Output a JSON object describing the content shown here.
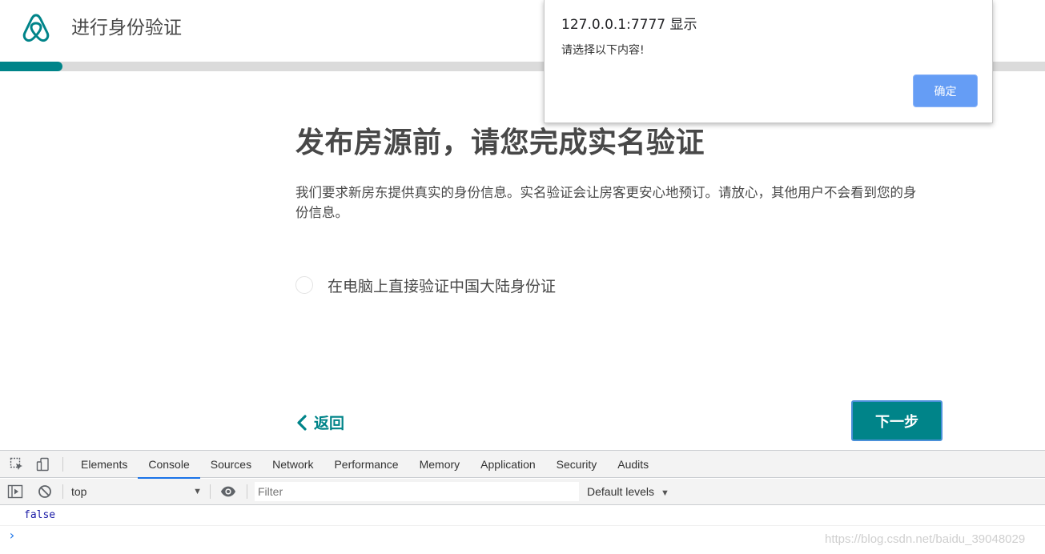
{
  "header": {
    "title": "进行身份验证",
    "logo_icon": "airbnb-logo-icon",
    "progress_fraction": 0.06
  },
  "main": {
    "heading": "发布房源前，请您完成实名验证",
    "description": "我们要求新房东提供真实的身份信息。实名验证会让房客更安心地预订。请放心，其他用户不会看到您的身份信息。",
    "option_label": "在电脑上直接验证中国大陆身份证",
    "back_label": "返回",
    "next_label": "下一步"
  },
  "alert": {
    "title": "127.0.0.1:7777 显示",
    "message": "请选择以下内容!",
    "ok_label": "确定"
  },
  "devtools": {
    "tabs": [
      {
        "label": "Elements"
      },
      {
        "label": "Console"
      },
      {
        "label": "Sources"
      },
      {
        "label": "Network"
      },
      {
        "label": "Performance"
      },
      {
        "label": "Memory"
      },
      {
        "label": "Application"
      },
      {
        "label": "Security"
      },
      {
        "label": "Audits"
      }
    ],
    "active_tab": "Console",
    "context": "top",
    "filter_placeholder": "Filter",
    "levels": "Default levels",
    "output": "false",
    "prompt": "›"
  },
  "watermark": "https://blog.csdn.net/baidu_39048029",
  "colors": {
    "brand": "#008489",
    "alert_button": "#659df5",
    "devtools_active": "#1a73e8"
  }
}
